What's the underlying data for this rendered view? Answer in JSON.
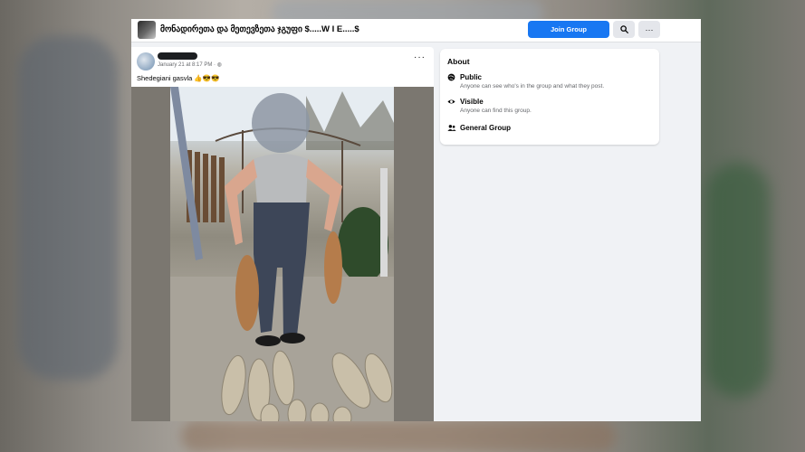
{
  "header": {
    "group_name": "მონადირეთა და მეთევზეთა ჯგუფი $.....W I E.....$",
    "join_label": "Join Group",
    "search_icon": "search-icon",
    "more_icon": "more-icon"
  },
  "post": {
    "meta": "January 21 at 8:17 PM ·",
    "text": "Shedegiani gasvla 👍😎😎",
    "more_label": "···"
  },
  "about": {
    "title": "About",
    "items": [
      {
        "icon": "globe-icon",
        "label": "Public",
        "desc": "Anyone can see who's in the group and what they post."
      },
      {
        "icon": "eye-icon",
        "label": "Visible",
        "desc": "Anyone can find this group."
      },
      {
        "icon": "people-icon",
        "label": "General Group",
        "desc": ""
      }
    ]
  },
  "colors": {
    "accent": "#1877f2",
    "surface": "#ffffff",
    "page_bg": "#f0f2f5"
  }
}
